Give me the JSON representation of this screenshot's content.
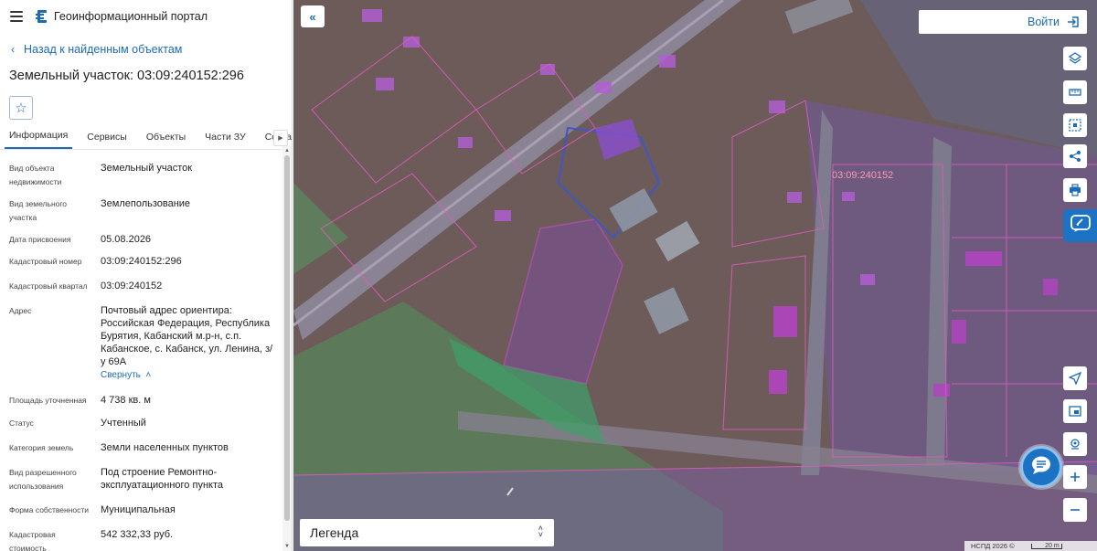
{
  "header": {
    "app_title": "Геоинформационный портал"
  },
  "back_link": {
    "label": "Назад к найденным объектам"
  },
  "object": {
    "title": "Земельный участок: 03:09:240152:296"
  },
  "tabs": [
    {
      "label": "Информация",
      "active": true
    },
    {
      "label": "Сервисы",
      "active": false
    },
    {
      "label": "Объекты",
      "active": false
    },
    {
      "label": "Части ЗУ",
      "active": false
    },
    {
      "label": "Состав",
      "active": false
    }
  ],
  "properties": [
    {
      "label": "Вид объекта недвижимости",
      "value": "Земельный участок"
    },
    {
      "label": "Вид земельного участка",
      "value": "Землепользование"
    },
    {
      "label": "Дата присвоения",
      "value": "05.08.2026"
    },
    {
      "label": "Кадастровый номер",
      "value": "03:09:240152:296"
    },
    {
      "label": "Кадастровый квартал",
      "value": "03:09:240152"
    },
    {
      "label": "Адрес",
      "value": "Почтовый адрес ориентира: Российская Федерация, Республика Бурятия, Кабанский м.р-н, с.п. Кабанское, с. Кабанск, ул. Ленина, з/у 69А",
      "action": "Свернуть"
    },
    {
      "label": "Площадь уточненная",
      "value": "4 738 кв. м"
    },
    {
      "label": "Статус",
      "value": "Учтенный"
    },
    {
      "label": "Категория земель",
      "value": "Земли населенных пунктов"
    },
    {
      "label": "Вид разрешенного использования",
      "value": "Под строение Ремонтно-эксплуатационного пункта"
    },
    {
      "label": "Форма собственности",
      "value": "Муниципальная"
    },
    {
      "label": "Кадастровая стоимость",
      "value": "542 332,33 руб."
    }
  ],
  "map": {
    "login_label": "Войти",
    "quarter_label": "03:09:240152",
    "legend_label": "Легенда",
    "attribution": "НСПД 2026 ©",
    "scale_label": "20 m",
    "accent_color": "#1c73c4"
  }
}
